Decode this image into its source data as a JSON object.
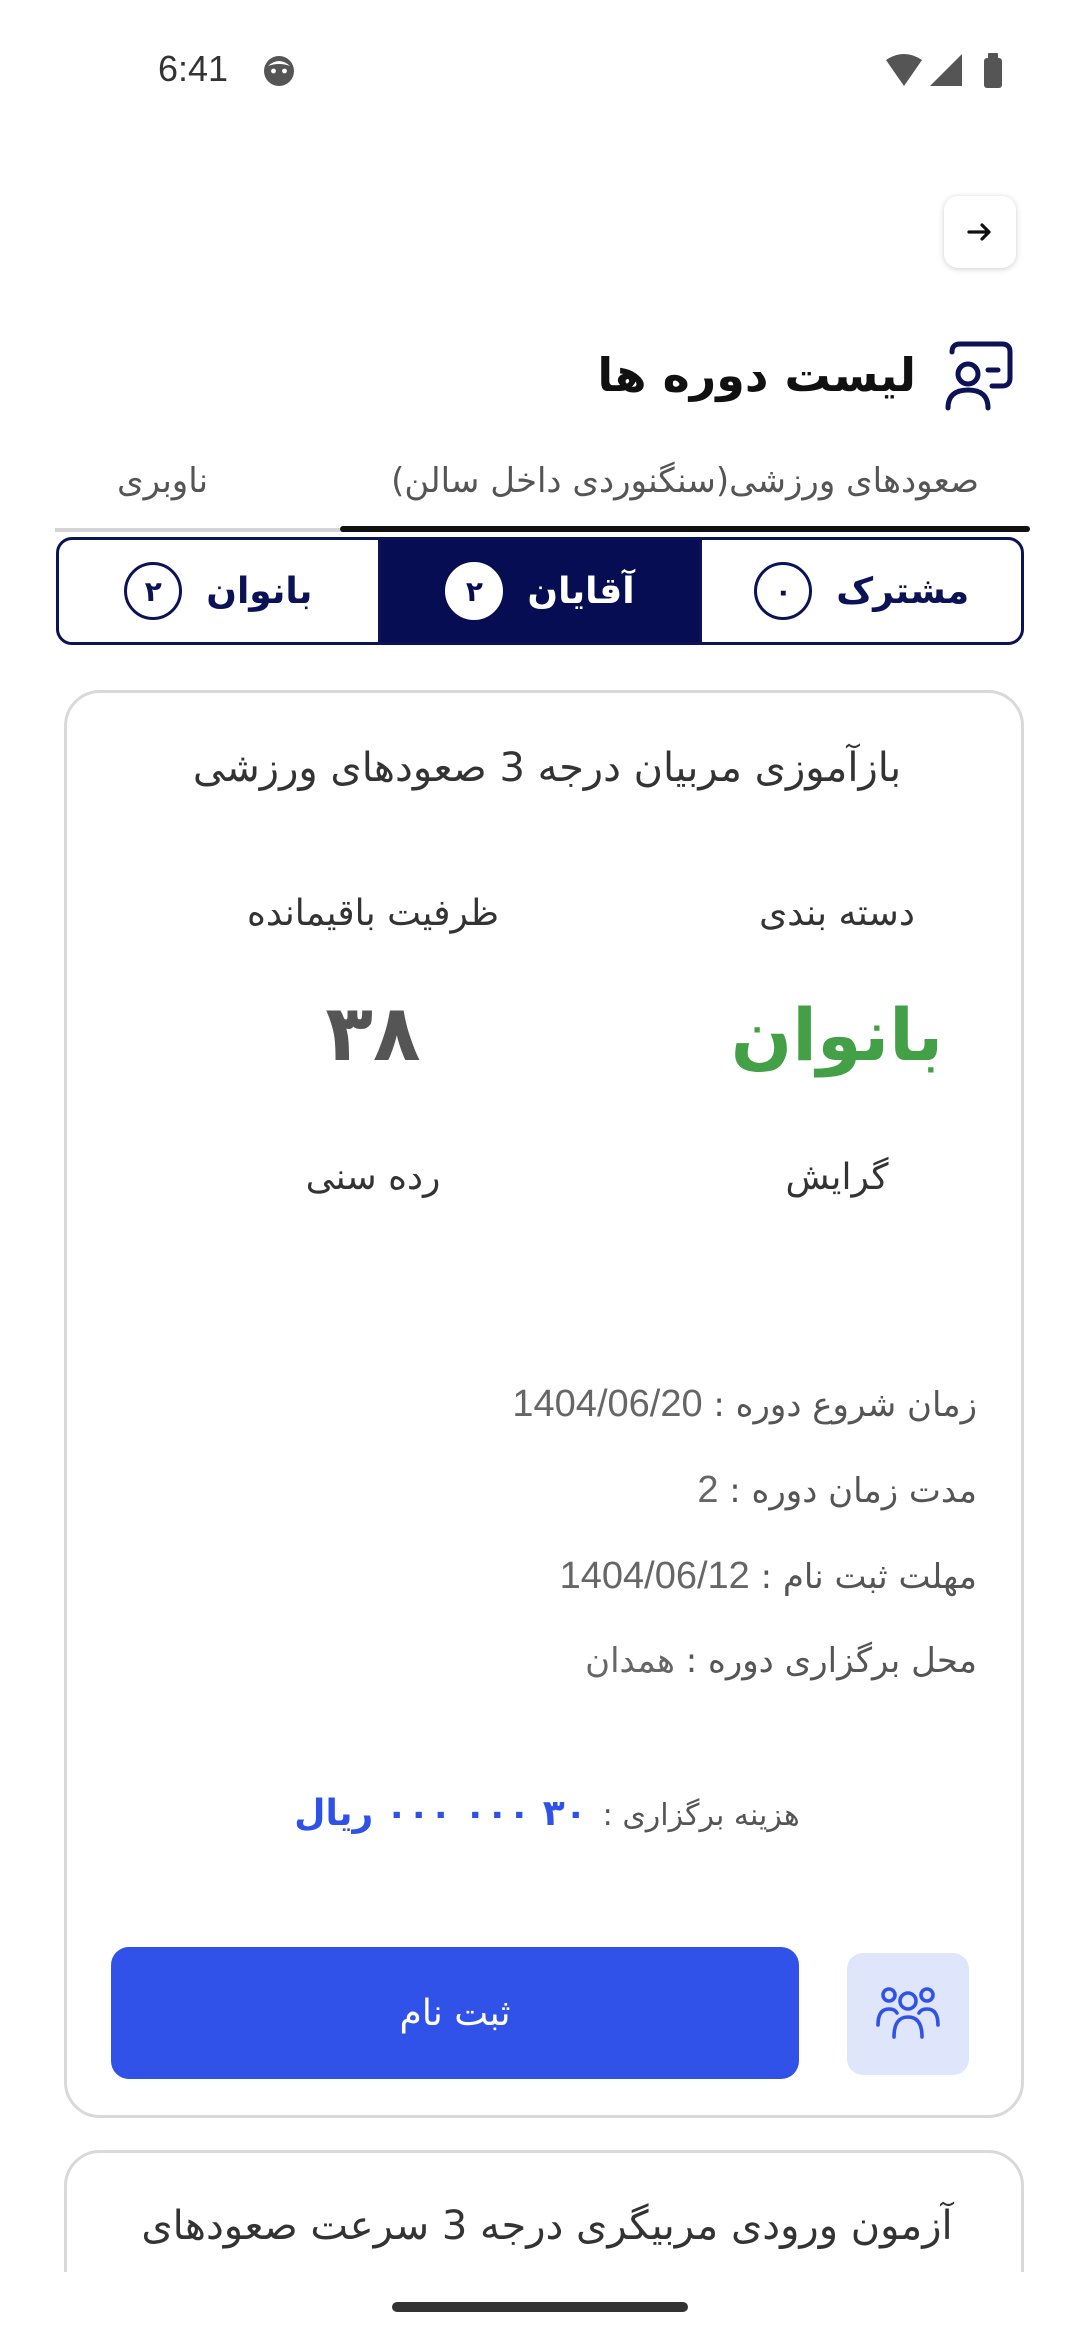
{
  "status_bar": {
    "time": "6:41"
  },
  "header": {
    "title": "لیست دوره ها"
  },
  "tabs": [
    {
      "label": "صعودهای ورزشی(سنگنوردی داخل سالن)",
      "active": true
    },
    {
      "label": "ناوبری",
      "active": false
    }
  ],
  "segments": [
    {
      "label": "مشترک",
      "count": "۰",
      "active": false
    },
    {
      "label": "آقایان",
      "count": "۲",
      "active": true
    },
    {
      "label": "بانوان",
      "count": "۲",
      "active": false
    }
  ],
  "course_card": {
    "title": "بازآموزی مربیان درجه 3 صعودهای ورزشی",
    "category_label": "دسته بندی",
    "category_value": "بانوان",
    "capacity_label": "ظرفیت باقیمانده",
    "capacity_value": "۳۸",
    "orientation_label": "گرایش",
    "age_group_label": "رده سنی",
    "start_label": "زمان شروع دوره :",
    "start_value": "1404/06/20",
    "duration_label": "مدت زمان دوره :",
    "duration_value": "2",
    "deadline_label": "مهلت ثبت نام :",
    "deadline_value": "1404/06/12",
    "location_label": "محل برگزاری دوره :",
    "location_value": "همدان",
    "fee_label": "هزینه برگزاری :",
    "fee_value": "۳۰ ۰۰۰ ۰۰۰ ریال",
    "register_label": "ثبت نام"
  },
  "next_card": {
    "title": "آزمون ورودی مربیگری درجه 3 سرعت صعودهای"
  },
  "colors": {
    "accent": "#3052e8",
    "navy": "#060d52",
    "green": "#43a047"
  }
}
